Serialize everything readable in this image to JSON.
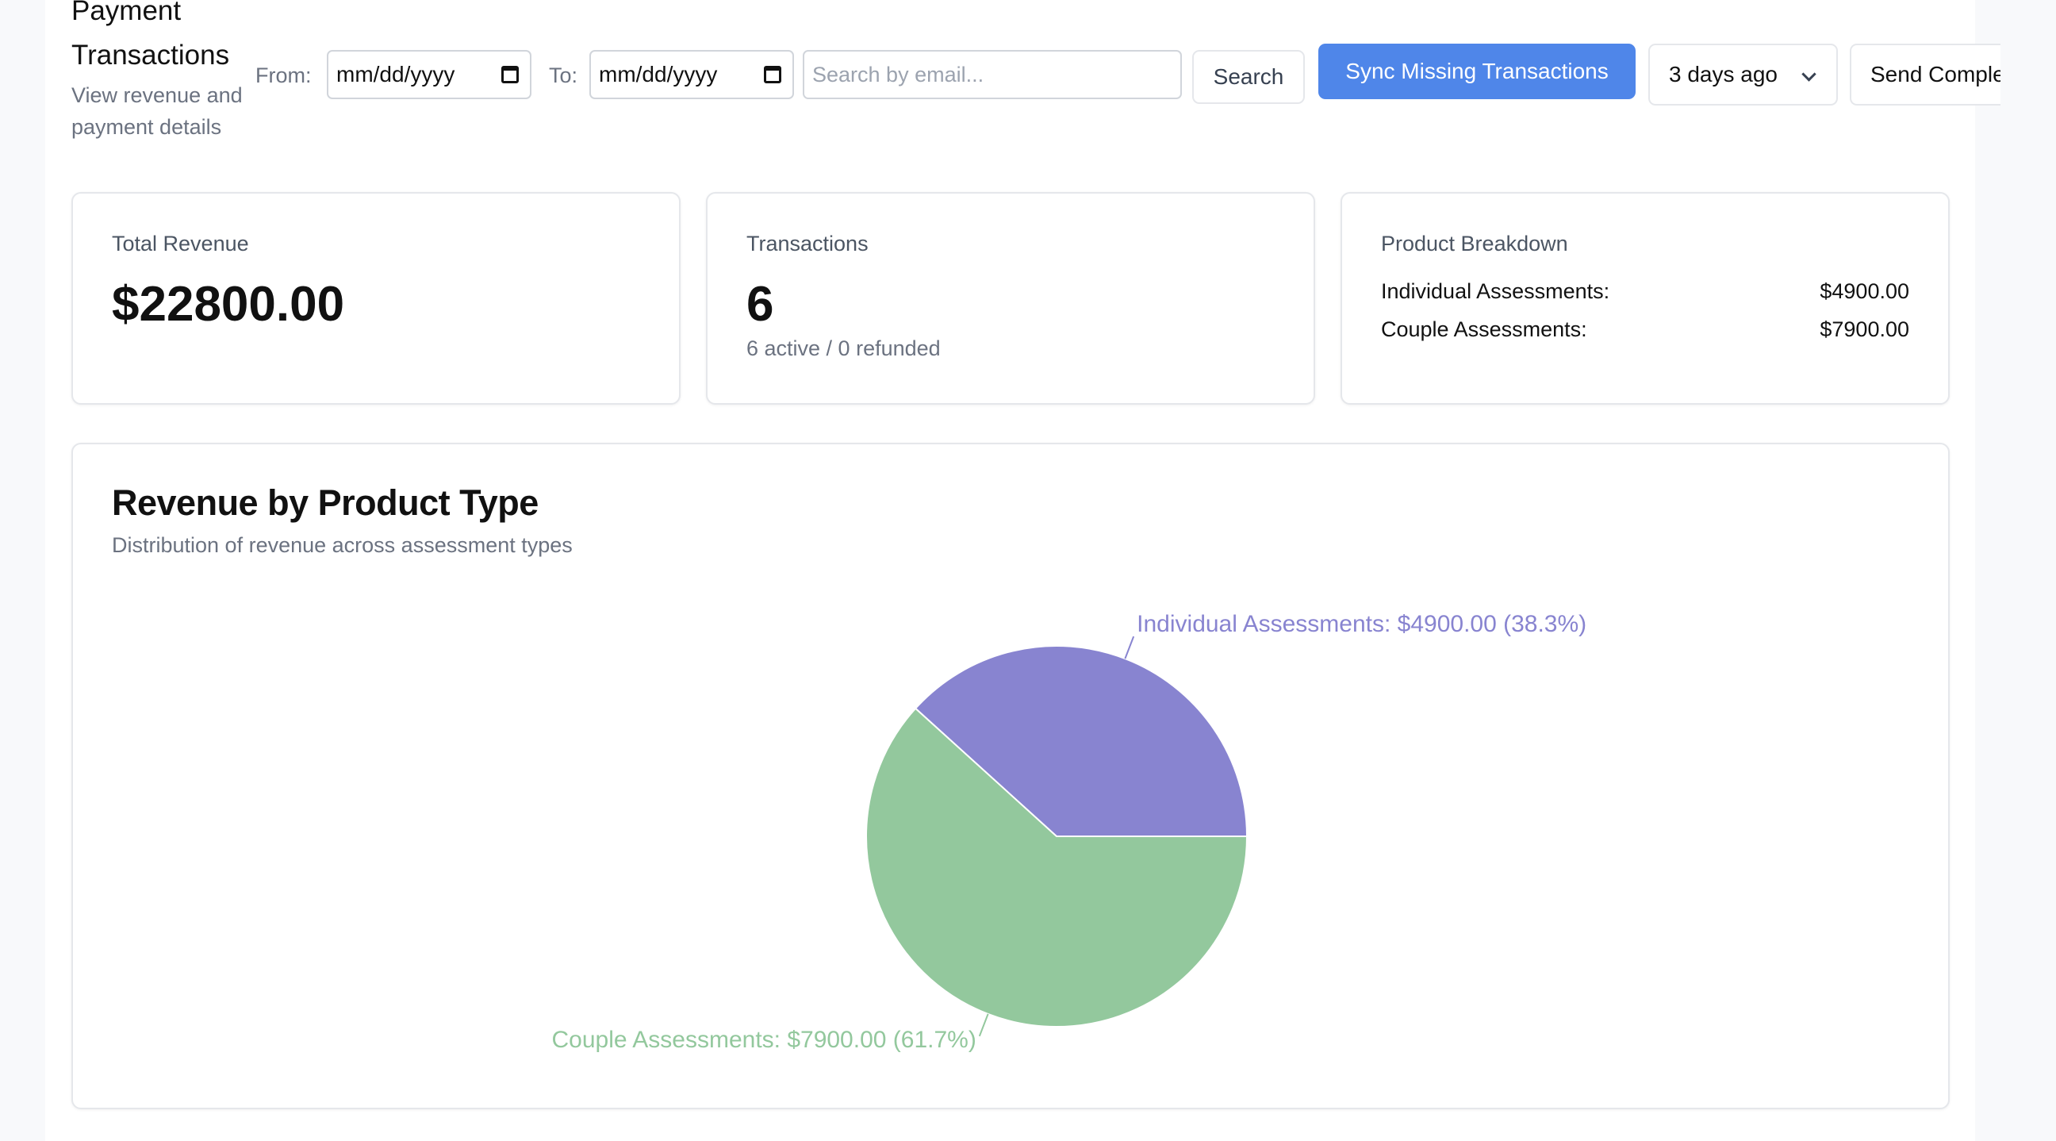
{
  "header": {
    "title": "Payment Transactions",
    "subtitle": "View revenue and payment details"
  },
  "filters": {
    "from_label": "From:",
    "from_value": "mm/dd/yyyy",
    "to_label": "To:",
    "to_value": "mm/dd/yyyy",
    "search_placeholder": "Search by email...",
    "search_button": "Search",
    "sync_button": "Sync Missing Transactions",
    "range_select": "3 days ago",
    "send_button": "Send Completion"
  },
  "cards": {
    "revenue": {
      "label": "Total Revenue",
      "value": "$22800.00"
    },
    "transactions": {
      "label": "Transactions",
      "value": "6",
      "sub": "6 active / 0 refunded"
    },
    "breakdown": {
      "label": "Product Breakdown",
      "rows": [
        {
          "name": "Individual Assessments:",
          "value": "$4900.00"
        },
        {
          "name": "Couple Assessments:",
          "value": "$7900.00"
        }
      ]
    }
  },
  "chart_panel": {
    "title": "Revenue by Product Type",
    "subtitle": "Distribution of revenue across assessment types"
  },
  "colors": {
    "primary": "#4f86e9",
    "individual": "#8884d0",
    "couple": "#93c89d"
  },
  "chart_data": {
    "type": "pie",
    "slices": [
      {
        "name": "Individual Assessments",
        "value": 4900.0,
        "percent": 38.3,
        "label": "Individual Assessments: $4900.00 (38.3%)",
        "color": "#8884d0"
      },
      {
        "name": "Couple Assessments",
        "value": 7900.0,
        "percent": 61.7,
        "label": "Couple Assessments: $7900.00 (61.7%)",
        "color": "#93c89d"
      }
    ]
  }
}
